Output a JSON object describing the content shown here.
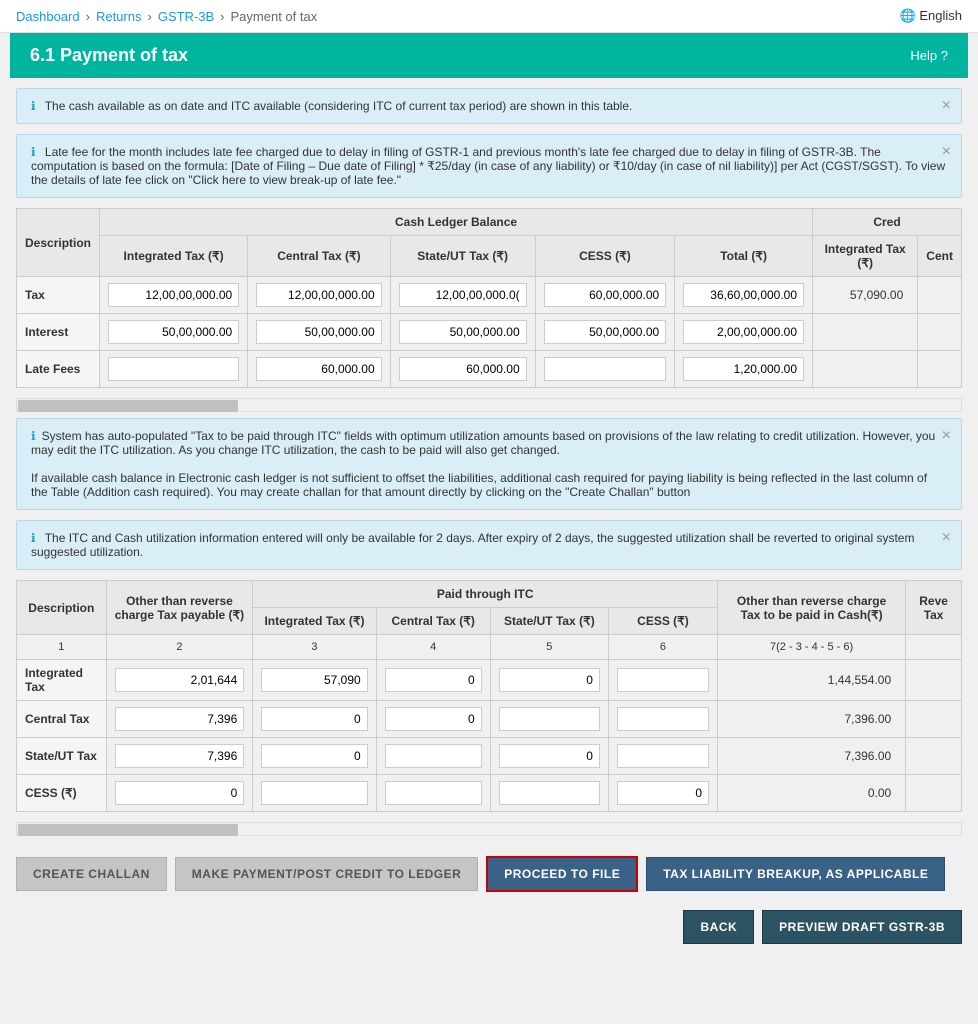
{
  "nav": {
    "dashboard": "Dashboard",
    "returns": "Returns",
    "gstr3b": "GSTR-3B",
    "current": "Payment of tax",
    "language": "English"
  },
  "header": {
    "title": "6.1 Payment of tax",
    "help": "Help"
  },
  "alerts": {
    "alert1": "The cash available as on date and ITC available (considering ITC of current tax period) are shown in this table.",
    "alert2": "Late fee for the month includes late fee charged due to delay in filing of GSTR-1 and previous month's late fee charged due to delay in filing of GSTR-3B. The computation is based on the formula: [Date of Filing – Due date of Filing] * ₹25/day (in case of any liability) or ₹10/day (in case of nil liability)] per Act (CGST/SGST). To view the details of late fee click on \"Click here to view break-up of late fee.\"",
    "alert3": "System has auto-populated \"Tax to be paid through ITC\" fields with optimum utilization amounts based on provisions of the law relating to credit utilization. However, you may edit the ITC utilization. As you change ITC utilization, the cash to be paid will also get changed.\n\nIf available cash balance in Electronic cash ledger is not sufficient to offset the liabilities, additional cash required for paying liability is being reflected in the last column of the Table (Addition cash required). You may create challan for that amount directly by clicking on the \"Create Challan\" button",
    "alert4": "The ITC and Cash utilization information entered will only be available for 2 days. After expiry of 2 days, the suggested utilization shall be reverted to original system suggested utilization."
  },
  "table1": {
    "headers": {
      "description": "Description",
      "cash_ledger": "Cash Ledger Balance",
      "integrated_tax": "Integrated Tax (₹)",
      "central_tax": "Central Tax (₹)",
      "state_ut_tax": "State/UT Tax (₹)",
      "cess": "CESS (₹)",
      "total": "Total (₹)",
      "credit_integrated": "Integrated Tax (₹)",
      "credit_label": "Cred"
    },
    "rows": [
      {
        "label": "Tax",
        "integrated": "12,00,00,000.00",
        "central": "12,00,00,000.00",
        "state_ut": "12,00,00,000.0(",
        "cess": "60,00,000.00",
        "total": "36,60,00,000.00",
        "credit_integrated": "57,090.00",
        "credit_cent": ""
      },
      {
        "label": "Interest",
        "integrated": "50,00,000.00",
        "central": "50,00,000.00",
        "state_ut": "50,00,000.00",
        "cess": "50,00,000.00",
        "total": "2,00,00,000.00",
        "credit_integrated": "",
        "credit_cent": ""
      },
      {
        "label": "Late Fees",
        "integrated": "",
        "central": "60,000.00",
        "state_ut": "60,000.00",
        "cess": "",
        "total": "1,20,000.00",
        "credit_integrated": "",
        "credit_cent": ""
      }
    ]
  },
  "table2": {
    "headers": {
      "description": "Description",
      "other_reverse": "Other than reverse charge Tax payable (₹)",
      "paid_itc": "Paid through ITC",
      "integrated_tax": "Integrated Tax (₹)",
      "central_tax": "Central Tax (₹)",
      "state_ut_tax": "State/UT Tax (₹)",
      "cess": "CESS (₹)",
      "other_reverse_cash": "Other than reverse charge Tax to be paid in Cash(₹)",
      "reve_tax": "Reve Tax"
    },
    "col_numbers": {
      "c1": "1",
      "c2": "2",
      "c3": "3",
      "c4": "4",
      "c5": "5",
      "c6": "6",
      "c7": "7(2 - 3 - 4 - 5 - 6)"
    },
    "rows": [
      {
        "label": "Integrated Tax",
        "c2": "2,01,644",
        "c3": "57,090",
        "c4": "0",
        "c5": "0",
        "c6": "",
        "c7": "1,44,554.00"
      },
      {
        "label": "Central Tax",
        "c2": "7,396",
        "c3": "0",
        "c4": "0",
        "c5": "",
        "c6": "",
        "c7": "7,396.00"
      },
      {
        "label": "State/UT Tax",
        "c2": "7,396",
        "c3": "0",
        "c4": "",
        "c5": "0",
        "c6": "",
        "c7": "7,396.00"
      },
      {
        "label": "CESS (₹)",
        "c2": "0",
        "c3": "",
        "c4": "",
        "c5": "",
        "c6": "0",
        "c7": "0.00"
      }
    ]
  },
  "buttons": {
    "create_challan": "CREATE CHALLAN",
    "make_payment": "MAKE PAYMENT/POST CREDIT TO LEDGER",
    "proceed_to_file": "PROCEED TO FILE",
    "tax_liability": "TAX LIABILITY BREAKUP, AS APPLICABLE",
    "back": "BACK",
    "preview_draft": "PREVIEW DRAFT GSTR-3B"
  }
}
